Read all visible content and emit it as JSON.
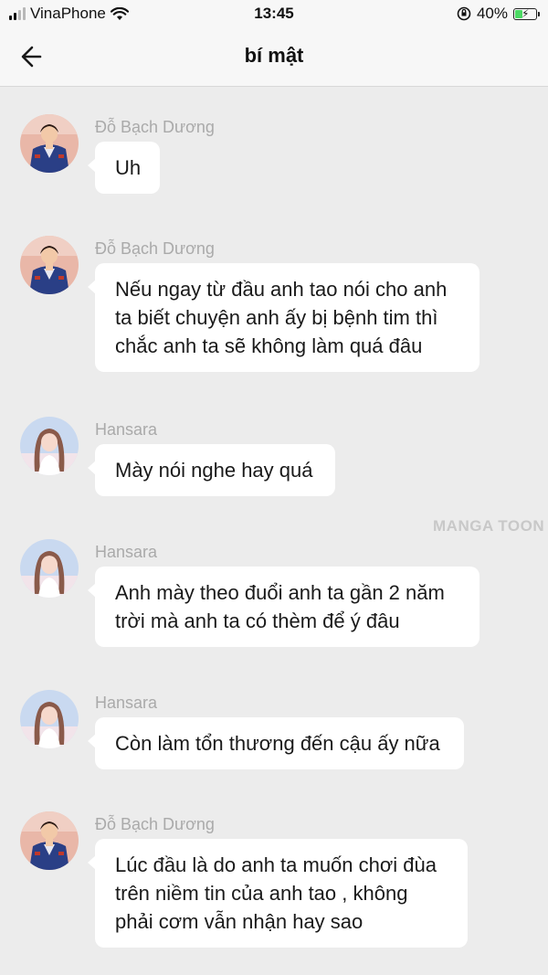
{
  "status_bar": {
    "carrier": "VinaPhone",
    "time": "13:45",
    "battery": "40%",
    "battery_level": 0.4
  },
  "header": {
    "title": "bí mật"
  },
  "watermark": "MANGA TOON",
  "messages": [
    {
      "sender": "Đỗ Bạch Dương",
      "avatar": "boy-avatar",
      "text": "Uh"
    },
    {
      "sender": "Đỗ Bạch Dương",
      "avatar": "boy-avatar",
      "text": "Nếu ngay từ đầu anh tao nói cho anh\nta biết chuyện anh ấy bị bệnh tim thì\nchắc anh ta sẽ không làm quá đâu"
    },
    {
      "sender": "Hansara",
      "avatar": "girl-avatar",
      "text": "Mày nói nghe hay quá"
    },
    {
      "sender": "Hansara",
      "avatar": "girl-avatar",
      "text": "Anh mày theo đuổi anh ta gần 2 năm\ntrời mà anh ta có thèm để ý đâu"
    },
    {
      "sender": "Hansara",
      "avatar": "girl-avatar",
      "text": "Còn làm tổn thương đến cậu ấy nữa"
    },
    {
      "sender": "Đỗ Bạch Dương",
      "avatar": "boy-avatar",
      "text": "Lúc đầu là do anh ta muốn chơi đùa\ntrên niềm tin của anh tao , không\nphải cơm vẫn nhận hay sao"
    }
  ]
}
